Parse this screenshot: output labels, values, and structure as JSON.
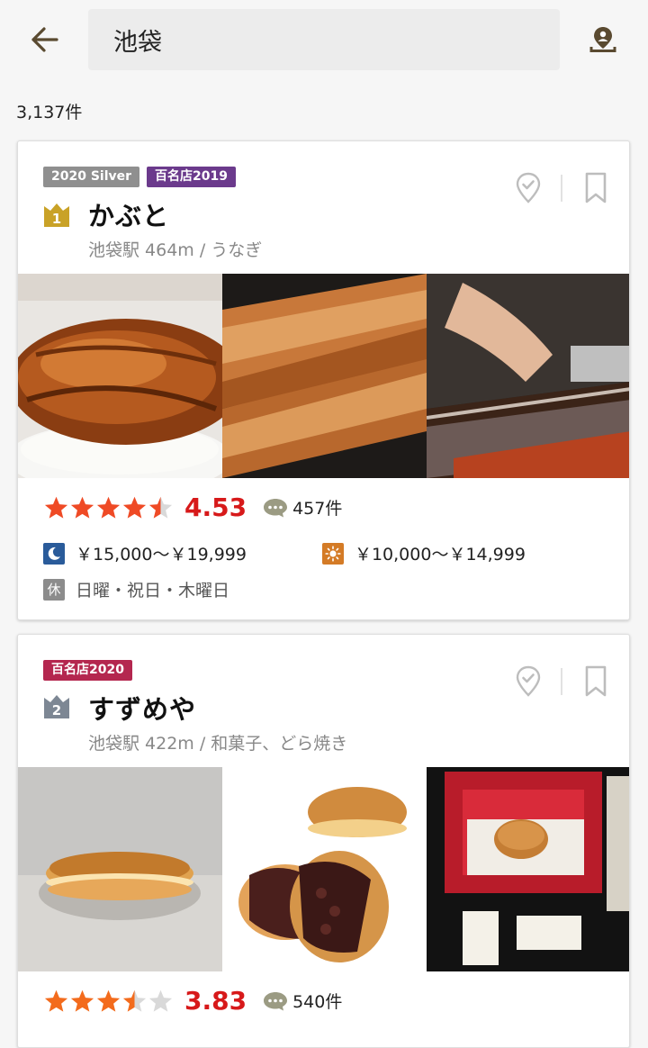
{
  "header": {
    "search_value": "池袋",
    "back_icon": "arrow-left-icon",
    "map_icon": "map-pin-person-icon"
  },
  "results": {
    "count_label": "3,137件"
  },
  "restaurants": [
    {
      "badges": [
        "2020 Silver",
        "百名店2019"
      ],
      "rank": "1",
      "name": "かぶと",
      "location": "池袋駅 464m / うなぎ",
      "rating": {
        "score": "4.53",
        "stars": 4.5,
        "reviews": "457件"
      },
      "dinner_price": "￥15,000～￥19,999",
      "lunch_price": "￥10,000～￥14,999",
      "closed_label": "休",
      "closed_days": "日曜・祝日・木曜日"
    },
    {
      "badges": [
        "百名店2020"
      ],
      "rank": "2",
      "name": "すずめや",
      "location": "池袋駅 422m / 和菓子、どら焼き",
      "rating": {
        "score": "3.83",
        "stars": 3.5,
        "reviews": "540件"
      }
    }
  ],
  "colors": {
    "accent_red": "#d7191a",
    "star_orange": "#ef4a25",
    "badge_silver": "#8f8f8f",
    "badge_purple": "#6b3a8c",
    "badge_crimson": "#b4274f",
    "rank_gold": "#c9a227",
    "rank_silver": "#7d8794"
  }
}
